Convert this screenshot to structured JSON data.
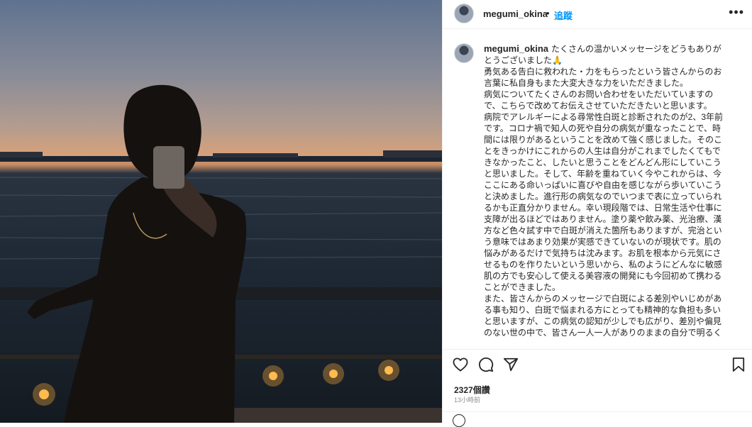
{
  "post": {
    "username": "megumi_okina",
    "dot": "•",
    "follow_label": "追蹤",
    "more_label": "•••",
    "caption_lines": [
      "たくさんの温かいメッセージをどうもありが",
      "とうございました🙏",
      "勇気ある告白に救われた・力をもらったという皆さんからのお",
      "言葉に私自身もまた大変大きな力をいただきました。",
      "病気についてたくさんのお問い合わせをいただいていますの",
      "で、こちらで改めてお伝えさせていただきたいと思います。",
      "病院でアレルギーによる尋常性白斑と診断されたのが2、3年前",
      "です。コロナ禍で知人の死や自分の病気が重なったことで、時",
      "間には限りがあるということを改めて強く感じました。そのこ",
      "とをきっかけにこれからの人生は自分がこれまでしたくてもで",
      "きなかったこと、したいと思うことをどんどん形にしていこう",
      "と思いました。そして、年齢を重ねていく今やこれからは、今",
      "ここにある命いっぱいに喜びや自由を感じながら歩いていこう",
      "と決めました。進行形の病気なのでいつまで表に立っていられ",
      "るかも正直分かりません。幸い現段階では、日常生活や仕事に",
      "支障が出るほどではありません。塗り薬や飲み薬、光治療、漢",
      "方など色々試す中で白斑が消えた箇所もありますが、完治とい",
      "う意味ではあまり効果が実感できていないのが現状です。肌の",
      "悩みがあるだけで気持ちは沈みます。お肌を根本から元気にさ",
      "せるものを作りたいという思いから、私のようにどんなに敏感",
      "肌の方でも安心して使える美容液の開発にも今回初めて携わる",
      "ことができました。",
      "また、皆さんからのメッセージで白斑による差別やいじめがあ",
      "る事も知り、白斑で悩まれる方にとっても精神的な負担も多い",
      "と思いますが、この病気の認知が少しでも広がり、差別や偏見",
      "のない世の中で、皆さん一人一人がありのままの自分で明るく"
    ],
    "likes": "2327個讚",
    "time": "13小時前"
  },
  "icons": {
    "like": "heart-icon",
    "comment": "comment-icon",
    "share": "share-icon",
    "save": "bookmark-icon",
    "menu": "more-icon"
  }
}
